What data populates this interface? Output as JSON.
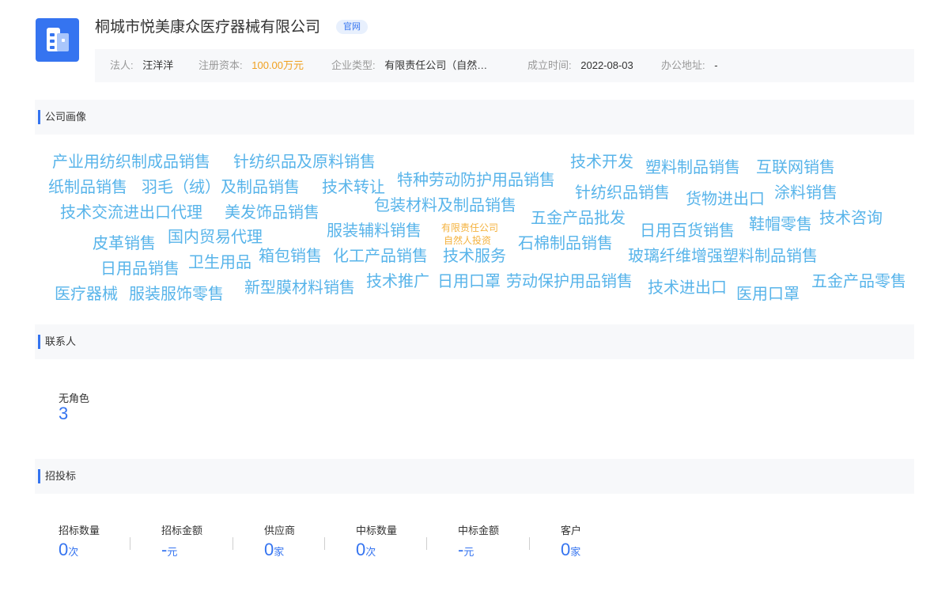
{
  "company": {
    "name": "桐城市悦美康众医疗器械有限公司",
    "badge": "官网"
  },
  "info": {
    "legal_rep_label": "法人:",
    "legal_rep": "汪洋洋",
    "capital_label": "注册资本:",
    "capital": "100.00万元",
    "type_label": "企业类型:",
    "type": "有限责任公司（自然…",
    "founded_label": "成立时间:",
    "founded": "2022-08-03",
    "address_label": "办公地址:",
    "address": "-"
  },
  "sections": {
    "portrait": "公司画像",
    "contacts": "联系人",
    "bidding": "招投标"
  },
  "word_cloud": [
    "产业用纺织制成品销售",
    "针纺织品及原料销售",
    "技术开发",
    "塑料制品销售",
    "互联网销售",
    "纸制品销售",
    "羽毛（绒）及制品销售",
    "技术转让",
    "特种劳动防护用品销售",
    "针纺织品销售",
    "货物进出口",
    "涂料销售",
    "技术交流进出口代理",
    "美发饰品销售",
    "包装材料及制品销售",
    "五金产品批发",
    "鞋帽零售",
    "技术咨询",
    "皮革销售",
    "国内贸易代理",
    "服装辅料销售",
    "有限责任公司",
    "自然人投资",
    "日用百货销售",
    "石棉制品销售",
    "日用品销售",
    "卫生用品",
    "箱包销售",
    "化工产品销售",
    "技术服务",
    "玻璃纤维增强塑料制品销售",
    "医疗器械",
    "服装服饰零售",
    "新型膜材料销售",
    "技术推广",
    "日用口罩",
    "劳动保护用品销售",
    "技术进出口",
    "医用口罩",
    "五金产品零售"
  ],
  "contacts": {
    "role_label": "无角色",
    "role_count": "3"
  },
  "bidding": [
    {
      "label": "招标数量",
      "value": "0",
      "unit": "次"
    },
    {
      "label": "招标金额",
      "value": "-",
      "unit": "元"
    },
    {
      "label": "供应商",
      "value": "0",
      "unit": "家"
    },
    {
      "label": "中标数量",
      "value": "0",
      "unit": "次"
    },
    {
      "label": "中标金额",
      "value": "-",
      "unit": "元"
    },
    {
      "label": "客户",
      "value": "0",
      "unit": "家"
    }
  ],
  "colors": {
    "accent": "#3574f0",
    "cloud_blue": "#58b4ea",
    "cloud_yellow": "#f4b23e",
    "money": "#f0a020"
  },
  "icons": {
    "logo": "building-icon"
  }
}
